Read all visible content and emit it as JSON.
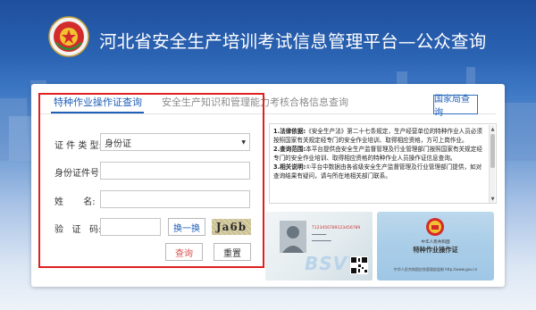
{
  "header": {
    "title": "河北省安全生产培训考试信息管理平台—公众查询",
    "emblem_icon": "safety-production-emblem",
    "emblem_text": "河北省安全生产"
  },
  "tabs": [
    {
      "label": "特种作业操作证查询",
      "active": true
    },
    {
      "label": "安全生产知识和管理能力考核合格信息查询",
      "active": false
    }
  ],
  "national_bureau_button": "国家局查询",
  "form": {
    "id_type_label": "证 件 类 型:",
    "id_type_value": "身份证",
    "id_number_label": "身份证件号:",
    "id_number_value": "",
    "name_label": "姓       名:",
    "name_value": "",
    "captcha_label": "验   证   码:",
    "captcha_value": "",
    "refresh_captcha_button": "换一换",
    "captcha_image_text": "Ja6b",
    "query_button": "查询",
    "reset_button": "重置"
  },
  "notes": [
    {
      "head": "1.法律依据:",
      "text": "《安全生产法》第二十七条规定，生产经营单位的特种作业人员必须按照国家有关规定经专门的安全作业培训、取得相应资格，方可上岗作业。"
    },
    {
      "head": "2.查询范围:",
      "text": "本平台提供由安全生产监督管理及行业管理部门按照国家有关规定经专门的安全作业培训、取得相应资格的特种作业人员操作证信息查询。"
    },
    {
      "head": "3.相关说明:",
      "text": "①平台中数据由各省级安全生产监督管理及行业管理部门提供，如对查询结果有疑问，请与所在地相关部门联系。"
    }
  ],
  "cards": {
    "card1_number": "T123456789123456789",
    "card1_watermark": "BSVV",
    "card2_top": "中华人民共和国",
    "card2_title": "特种作业操作证",
    "card2_foot": "中华人民共和国应急管理部监制  http://www.gov.cn"
  },
  "colors": {
    "accent": "#1f5fb7",
    "highlight": "#e02020",
    "query_text": "#d9534f"
  }
}
